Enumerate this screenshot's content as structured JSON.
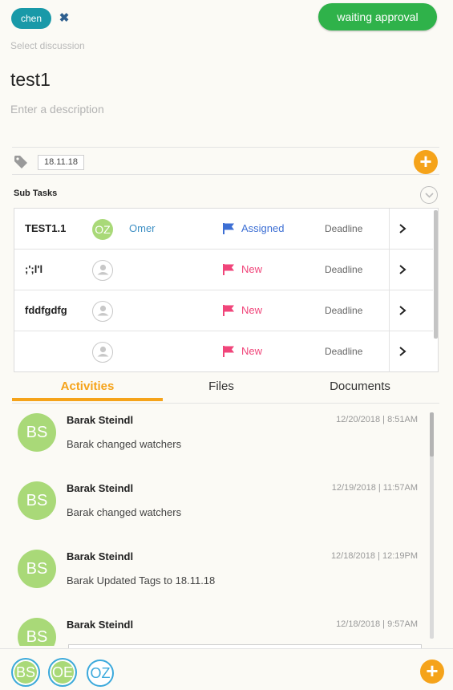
{
  "header": {
    "assignee_chip": "chen",
    "remove_icon": "close-icon",
    "status_button": "waiting approval",
    "discussion_placeholder": "Select discussion",
    "title": "test1",
    "description_placeholder": "Enter a description"
  },
  "tags": {
    "icon": "tag-icon",
    "items": [
      "18.11.18"
    ],
    "add_icon": "plus-icon"
  },
  "subtasks": {
    "label": "Sub Tasks",
    "collapse_icon": "chevron-down-circle-icon",
    "rows": [
      {
        "name": "TEST1.1",
        "avatar": "OZ",
        "owner": "Omer",
        "status": "Assigned",
        "deadline": "Deadline"
      },
      {
        "name": ";';l'l",
        "avatar": "",
        "owner": "",
        "status": "New",
        "deadline": "Deadline"
      },
      {
        "name": "fddfgdfg",
        "avatar": "",
        "owner": "",
        "status": "New",
        "deadline": "Deadline"
      },
      {
        "name": "",
        "avatar": "",
        "owner": "",
        "status": "New",
        "deadline": "Deadline"
      }
    ]
  },
  "tabs": [
    {
      "label": "Activities",
      "active": true
    },
    {
      "label": "Files",
      "active": false
    },
    {
      "label": "Documents",
      "active": false
    }
  ],
  "activities": [
    {
      "avatar": "BS",
      "user": "Barak Steindl",
      "time": "12/20/2018 | 8:51AM",
      "text": "Barak changed watchers"
    },
    {
      "avatar": "BS",
      "user": "Barak Steindl",
      "time": "12/19/2018 | 11:57AM",
      "text": "Barak changed watchers"
    },
    {
      "avatar": "BS",
      "user": "Barak Steindl",
      "time": "12/18/2018 | 12:19PM",
      "text": "Barak Updated Tags to 18.11.18"
    },
    {
      "avatar": "BS",
      "user": "Barak Steindl",
      "time": "12/18/2018 | 9:57AM",
      "text": ""
    }
  ],
  "watchers": [
    "BS",
    "OE",
    "OZ"
  ],
  "colors": {
    "accent": "#f5a31a",
    "status_green": "#2fb24a",
    "chip_teal": "#1999a8",
    "assigned_blue": "#3d6fd4",
    "new_pink": "#f0457a",
    "avatar_green": "#a9d978"
  }
}
